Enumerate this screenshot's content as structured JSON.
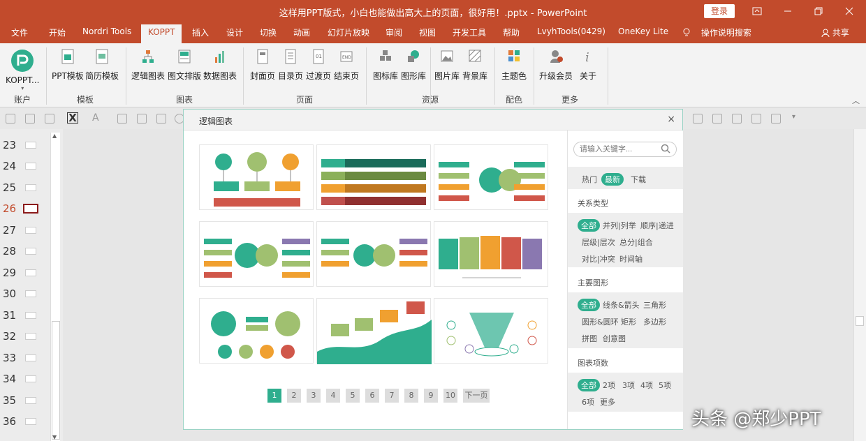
{
  "window": {
    "title": "这样用PPT版式，小白也能做出高大上的页面，很好用！.pptx - PowerPoint",
    "login_label": "登录",
    "share_label": "共享"
  },
  "tabs": [
    "文件",
    "开始",
    "Nordri Tools",
    "KOPPT",
    "插入",
    "设计",
    "切换",
    "动画",
    "幻灯片放映",
    "审阅",
    "视图",
    "开发工具",
    "帮助",
    "LvyhTools(0429)",
    "OneKey Lite",
    "操作说明搜索"
  ],
  "active_tab": "KOPPT",
  "ribbon": {
    "account": {
      "button": "KOPPT...",
      "group": "账户"
    },
    "template": {
      "buttons": [
        "PPT模板",
        "简历模板"
      ],
      "group": "模板"
    },
    "chart": {
      "buttons": [
        "逻辑图表",
        "图文排版",
        "数据图表"
      ],
      "group": "图表"
    },
    "page": {
      "buttons": [
        "封面页",
        "目录页",
        "过渡页",
        "结束页"
      ],
      "group": "页面"
    },
    "resource": {
      "buttons": [
        "图标库",
        "图形库",
        "图片库",
        "背景库"
      ],
      "group": "资源"
    },
    "color": {
      "buttons": [
        "主题色"
      ],
      "group": "配色"
    },
    "more": {
      "buttons": [
        "升级会员",
        "关于"
      ],
      "group": "更多"
    }
  },
  "slides": [
    "23",
    "24",
    "25",
    "26",
    "27",
    "28",
    "29",
    "30",
    "31",
    "32",
    "33",
    "34",
    "35",
    "36"
  ],
  "current_slide": "26",
  "dialog": {
    "title": "逻辑图表",
    "close": "×",
    "search_placeholder": "请输入关键字...",
    "sort_tabs": [
      "热门",
      "最新",
      "下载"
    ],
    "sort_active": "最新",
    "sections": [
      {
        "title": "关系类型",
        "options": [
          "全部",
          "并列|列举",
          "顺序|递进",
          "层级|层次",
          "总分|组合",
          "对比|冲突",
          "时间轴"
        ]
      },
      {
        "title": "主要图形",
        "options": [
          "全部",
          "线条&箭头",
          "三角形",
          "圆形&圆环",
          "矩形",
          "多边形",
          "拼图",
          "创意图"
        ]
      },
      {
        "title": "图表项数",
        "options": [
          "全部",
          "2项",
          "3项",
          "4项",
          "5项",
          "6项",
          "更多"
        ]
      }
    ],
    "pages": [
      "1",
      "2",
      "3",
      "4",
      "5",
      "6",
      "7",
      "8",
      "9",
      "10"
    ],
    "current_page": "1",
    "next_label": "下一页"
  },
  "watermark": "头条 @郑少PPT",
  "colors": {
    "brand": "#c24b2c",
    "accent": "#2fae8e",
    "orange": "#f0a030",
    "red": "#d0574a",
    "green": "#a0c070",
    "purple": "#8a78b0"
  }
}
